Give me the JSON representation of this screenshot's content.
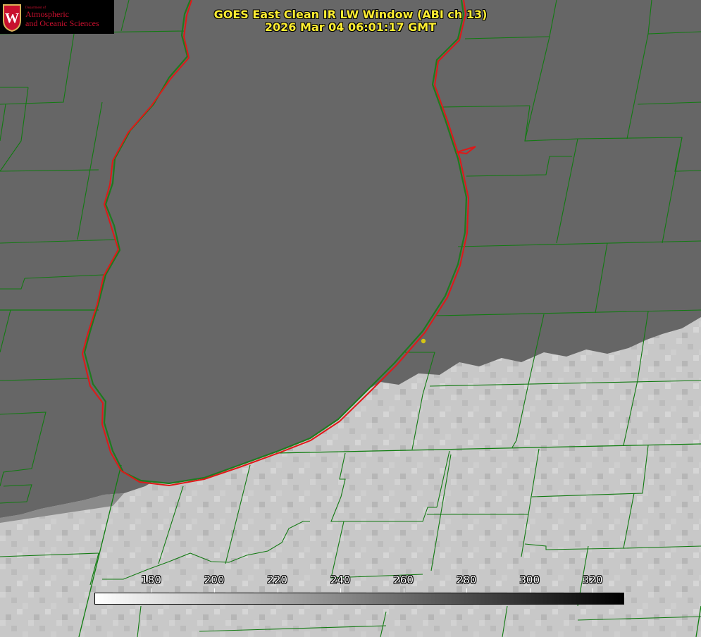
{
  "title": {
    "line1": "GOES East Clean IR LW Window (ABI ch 13)",
    "line2": "2026 Mar 04 06:01:17 GMT"
  },
  "logo": {
    "department": "Department of",
    "name_line1": "Atmospheric",
    "name_line2": "and Oceanic Sciences",
    "crest_letter": "W"
  },
  "colorbar": {
    "min": 162,
    "max": 330,
    "ticks": [
      180,
      200,
      220,
      240,
      260,
      280,
      300,
      320
    ],
    "gradient_start": "#ffffff",
    "gradient_end": "#000000"
  },
  "colors": {
    "clear_sky": "#6a6a6a",
    "cloud": "#c8c8c8",
    "shoreline": "#e01818",
    "boundaries": "#127a12",
    "title_text": "#ffee33",
    "logo_red": "#c8102e",
    "station_marker": "#d4c414"
  }
}
